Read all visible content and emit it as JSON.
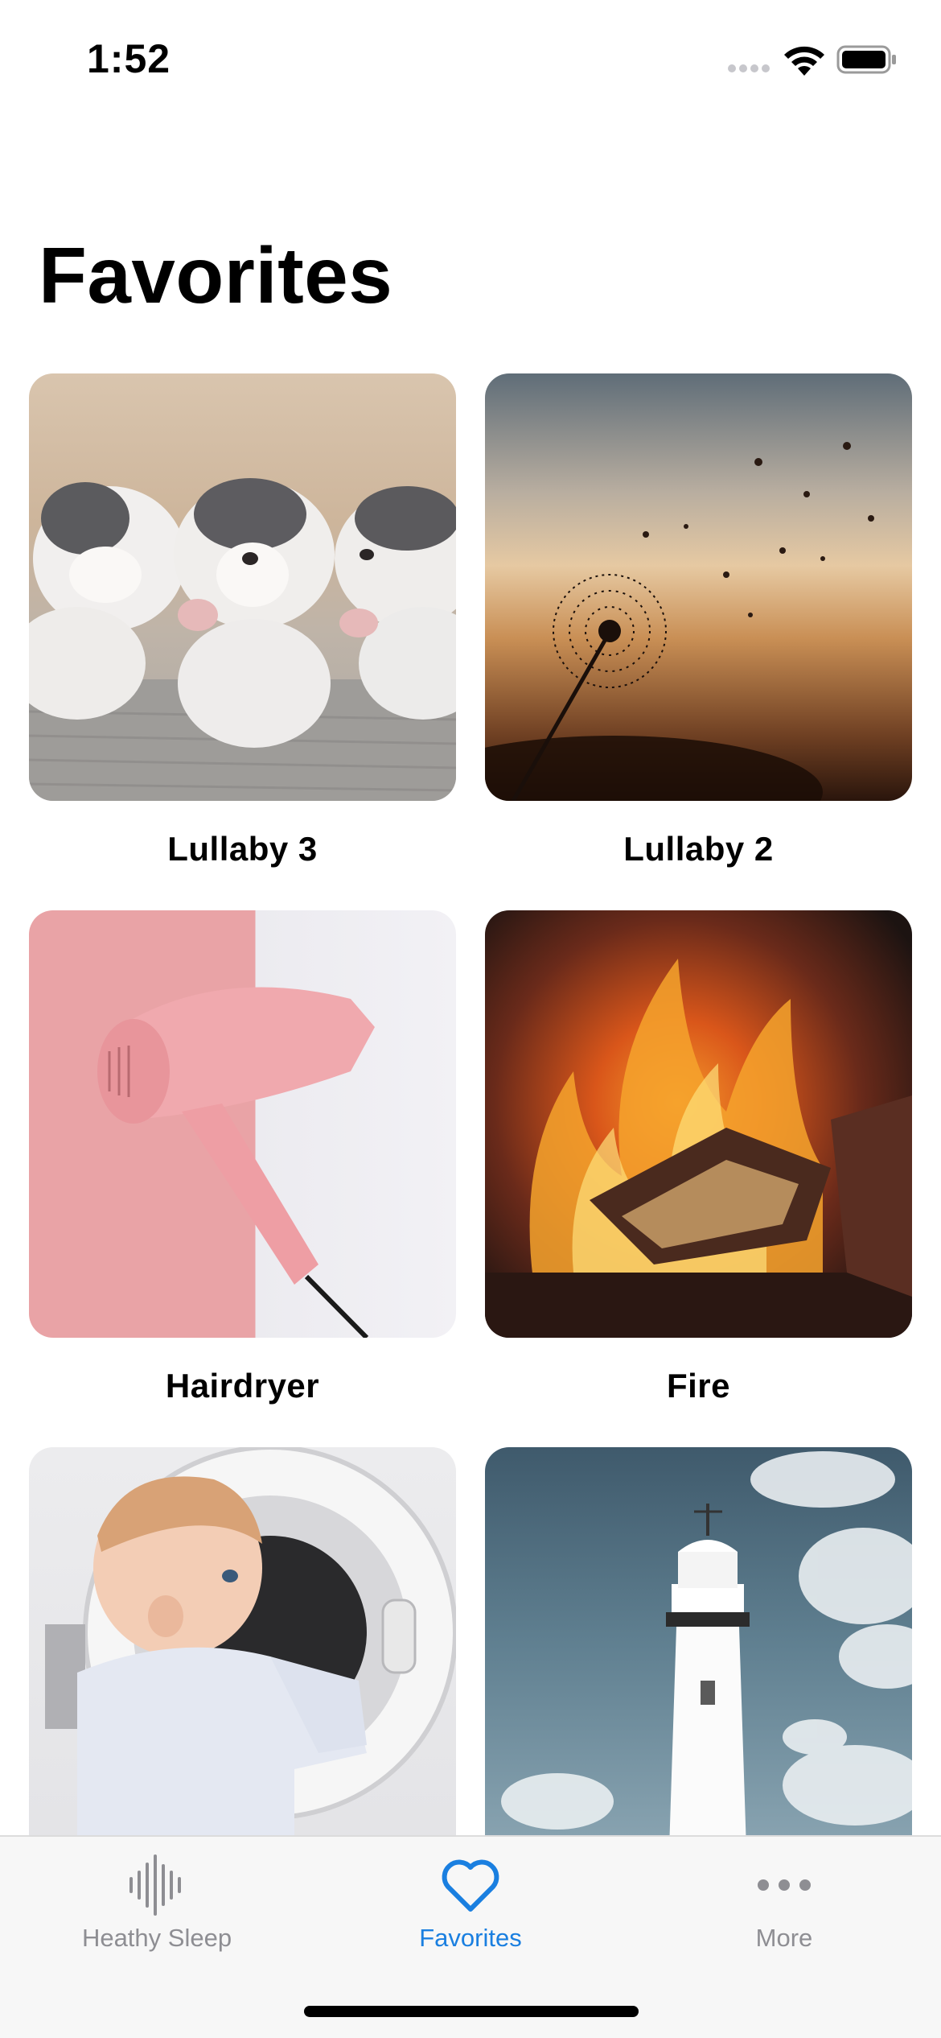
{
  "status_bar": {
    "time": "1:52"
  },
  "page": {
    "title": "Favorites"
  },
  "favorites": [
    {
      "label": "Lullaby 3",
      "icon": "sleeping-puppies-photo"
    },
    {
      "label": "Lullaby 2",
      "icon": "dandelion-sunset-photo"
    },
    {
      "label": "Hairdryer",
      "icon": "pink-hairdryer-photo"
    },
    {
      "label": "Fire",
      "icon": "campfire-photo"
    },
    {
      "label": "",
      "icon": "baby-washing-machine-photo"
    },
    {
      "label": "",
      "icon": "lighthouse-photo"
    }
  ],
  "tab_bar": {
    "tabs": [
      {
        "label": "Heathy Sleep",
        "icon": "waveform-icon",
        "active": false
      },
      {
        "label": "Favorites",
        "icon": "heart-icon",
        "active": true
      },
      {
        "label": "More",
        "icon": "ellipsis-icon",
        "active": false
      }
    ],
    "active_color": "#1a7fe0",
    "inactive_color": "#8e8e93"
  }
}
